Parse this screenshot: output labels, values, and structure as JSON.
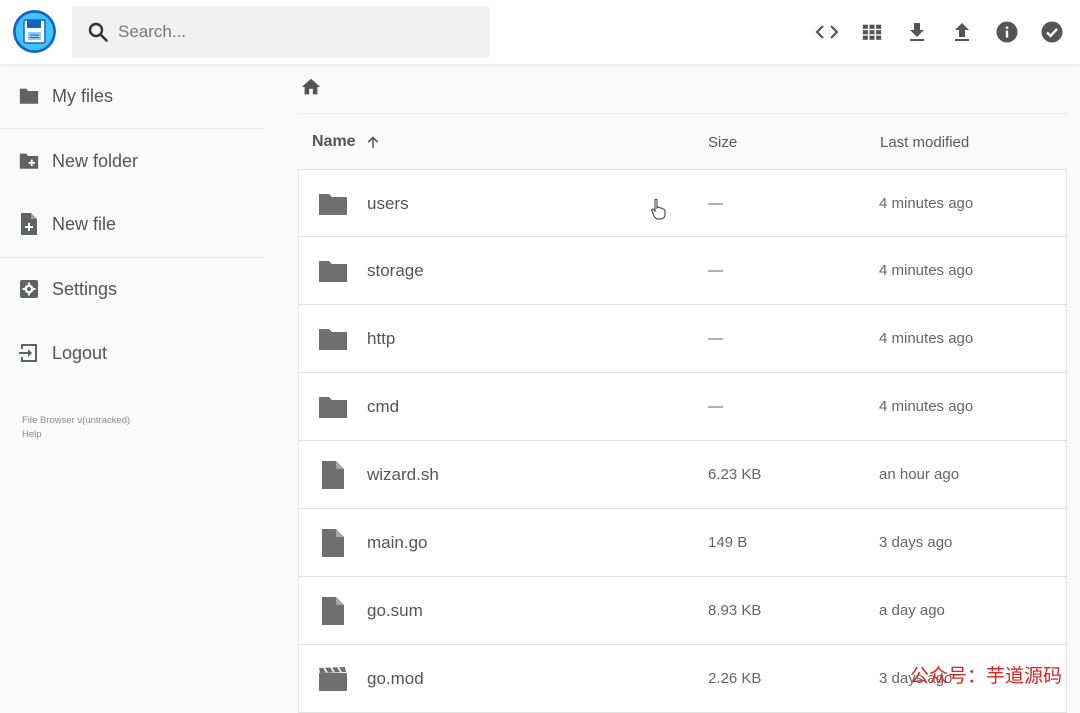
{
  "header": {
    "search_placeholder": "Search...",
    "actions": [
      {
        "icon": "code-icon",
        "label": "Toggle shell"
      },
      {
        "icon": "grid-view-icon",
        "label": "Switch view"
      },
      {
        "icon": "download-icon",
        "label": "Download"
      },
      {
        "icon": "upload-icon",
        "label": "Upload"
      },
      {
        "icon": "info-icon",
        "label": "Info"
      },
      {
        "icon": "check-circle-icon",
        "label": "Select multiple"
      }
    ]
  },
  "sidebar": {
    "items": [
      {
        "label": "My files",
        "icon": "folder-icon"
      },
      {
        "label": "New folder",
        "icon": "create-new-folder-icon"
      },
      {
        "label": "New file",
        "icon": "note-add-icon"
      },
      {
        "label": "Settings",
        "icon": "settings-icon"
      },
      {
        "label": "Logout",
        "icon": "exit-icon"
      }
    ],
    "credits": {
      "version": "File Browser v(untracked)",
      "help": "Help"
    }
  },
  "table": {
    "headers": {
      "name": "Name",
      "size": "Size",
      "modified": "Last modified"
    },
    "sort_icon": "arrow-upward-icon",
    "rows": [
      {
        "name": "users",
        "size": "—",
        "modified": "4 minutes ago",
        "icon": "folder-icon"
      },
      {
        "name": "storage",
        "size": "—",
        "modified": "4 minutes ago",
        "icon": "folder-icon"
      },
      {
        "name": "http",
        "size": "—",
        "modified": "4 minutes ago",
        "icon": "folder-icon"
      },
      {
        "name": "cmd",
        "size": "—",
        "modified": "4 minutes ago",
        "icon": "folder-icon"
      },
      {
        "name": "wizard.sh",
        "size": "6.23 KB",
        "modified": "an hour ago",
        "icon": "file-icon"
      },
      {
        "name": "main.go",
        "size": "149 B",
        "modified": "3 days ago",
        "icon": "file-icon"
      },
      {
        "name": "go.sum",
        "size": "8.93 KB",
        "modified": "a day ago",
        "icon": "file-icon"
      },
      {
        "name": "go.mod",
        "size": "2.26 KB",
        "modified": "3 days ago",
        "icon": "movie-icon"
      }
    ]
  },
  "colors": {
    "accent": "#2979ff",
    "icon": "#6f6f6f",
    "logo_bg": "#2979ff"
  },
  "watermark": {
    "text": "公众号：芋道源码"
  }
}
